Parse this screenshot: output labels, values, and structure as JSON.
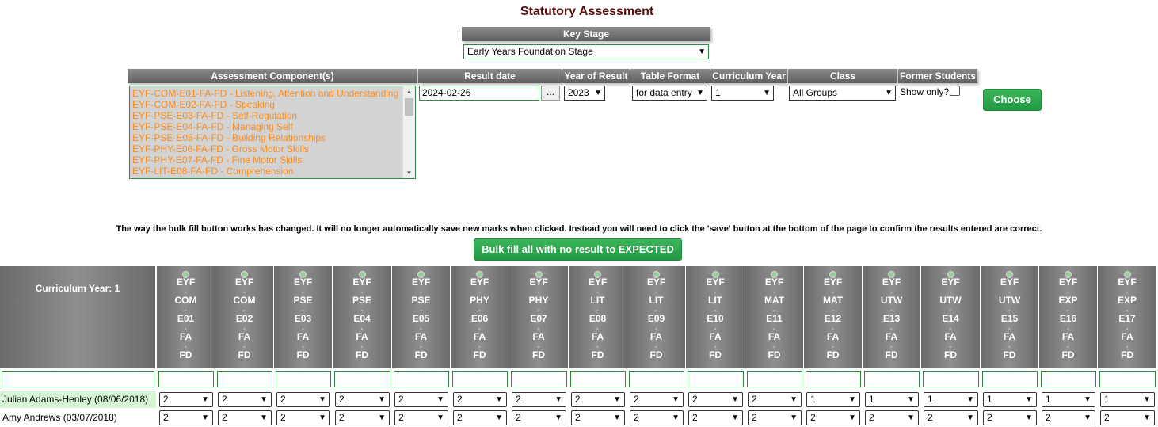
{
  "title": "Statutory Assessment",
  "key_stage": {
    "label": "Key Stage",
    "value": "Early Years Foundation Stage"
  },
  "filters": {
    "headers": [
      "Assessment Component(s)",
      "Result date",
      "Year of Result",
      "Table Format",
      "Curriculum Year",
      "Class",
      "Former Students"
    ],
    "components": [
      "EYF-COM-E01-FA-FD - Listening, Attention and Understanding",
      "EYF-COM-E02-FA-FD - Speaking",
      "EYF-PSE-E03-FA-FD - Self-Regulation",
      "EYF-PSE-E04-FA-FD - Managing Self",
      "EYF-PSE-E05-FA-FD - Building Relationships",
      "EYF-PHY-E06-FA-FD - Gross Motor Skills",
      "EYF-PHY-E07-FA-FD - Fine Motor Skills",
      "EYF-LIT-E08-FA-FD - Comprehension"
    ],
    "result_date": "2024-02-26",
    "date_button": "...",
    "year_of_result": "2023",
    "table_format": "for data entry",
    "curriculum_year": "1",
    "class": "All Groups",
    "former_label": "Show only?",
    "choose_button": "Choose"
  },
  "notice": "The way the bulk fill button works has changed. It will no longer automatically save new marks when clicked. Instead you will need to click the 'save' button at the bottom of the page to confirm the results entered are correct.",
  "bulk_button": "Bulk fill all with no result to EXPECTED",
  "grid": {
    "corner_label": "Curriculum Year: 1",
    "columns": [
      [
        "EYF",
        "COM",
        "E01",
        "FA",
        "FD"
      ],
      [
        "EYF",
        "COM",
        "E02",
        "FA",
        "FD"
      ],
      [
        "EYF",
        "PSE",
        "E03",
        "FA",
        "FD"
      ],
      [
        "EYF",
        "PSE",
        "E04",
        "FA",
        "FD"
      ],
      [
        "EYF",
        "PSE",
        "E05",
        "FA",
        "FD"
      ],
      [
        "EYF",
        "PHY",
        "E06",
        "FA",
        "FD"
      ],
      [
        "EYF",
        "PHY",
        "E07",
        "FA",
        "FD"
      ],
      [
        "EYF",
        "LIT",
        "E08",
        "FA",
        "FD"
      ],
      [
        "EYF",
        "LIT",
        "E09",
        "FA",
        "FD"
      ],
      [
        "EYF",
        "LIT",
        "E10",
        "FA",
        "FD"
      ],
      [
        "EYF",
        "MAT",
        "E11",
        "FA",
        "FD"
      ],
      [
        "EYF",
        "MAT",
        "E12",
        "FA",
        "FD"
      ],
      [
        "EYF",
        "UTW",
        "E13",
        "FA",
        "FD"
      ],
      [
        "EYF",
        "UTW",
        "E14",
        "FA",
        "FD"
      ],
      [
        "EYF",
        "UTW",
        "E15",
        "FA",
        "FD"
      ],
      [
        "EYF",
        "EXP",
        "E16",
        "FA",
        "FD"
      ],
      [
        "EYF",
        "EXP",
        "E17",
        "FA",
        "FD"
      ]
    ],
    "rows": [
      {
        "name": "Julian Adams-Henley (08/06/2018)",
        "values": [
          "2",
          "2",
          "2",
          "2",
          "2",
          "2",
          "2",
          "2",
          "2",
          "2",
          "2",
          "1",
          "1",
          "1",
          "1",
          "1",
          "1"
        ]
      },
      {
        "name": "Amy Andrews (03/07/2018)",
        "values": [
          "2",
          "2",
          "2",
          "2",
          "2",
          "2",
          "2",
          "2",
          "2",
          "2",
          "2",
          "2",
          "2",
          "2",
          "2",
          "2",
          "2"
        ]
      }
    ]
  }
}
